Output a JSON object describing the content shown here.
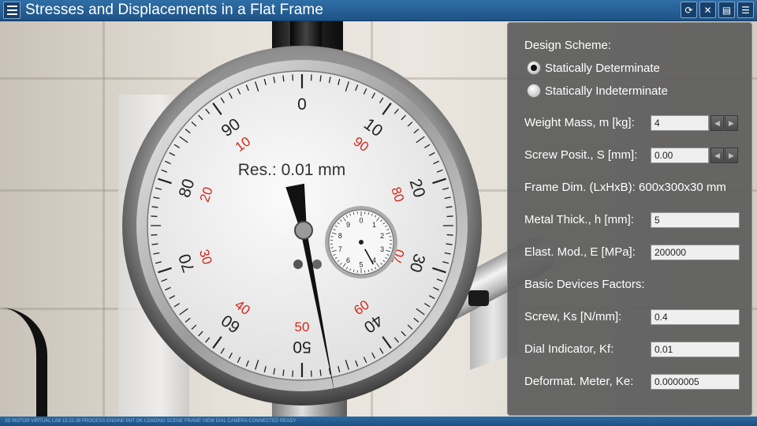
{
  "app": {
    "title": "Stresses and Displacements in a Flat Frame",
    "status_text": "3D MOTOR VIRTUAL LAB 15.22.38 PROCESS ENGINE INIT OK  LOADING SCENE  FRAME VIEW  DIAL CAMERA  CONNECTED  READY"
  },
  "toolbar": {
    "menu_icon": "hamburger-menu-icon",
    "buttons": [
      {
        "name": "reset-view-button",
        "icon": "refresh-icon",
        "glyph": "⟳"
      },
      {
        "name": "mute-sound-button",
        "icon": "speaker-mute-icon",
        "glyph": "✕"
      },
      {
        "name": "theory-book-button",
        "icon": "book-icon",
        "glyph": "▤"
      },
      {
        "name": "settings-list-button",
        "icon": "list-icon",
        "glyph": "☰"
      }
    ]
  },
  "panel": {
    "design_scheme_label": "Design Scheme:",
    "scheme_options": [
      {
        "label": "Statically Determinate",
        "selected": true
      },
      {
        "label": "Statically Indeterminate",
        "selected": false
      }
    ],
    "weight_mass_label": "Weight Mass, m [kg]:",
    "weight_mass_value": "4",
    "screw_position_label": "Screw Posit., S [mm]:",
    "screw_position_value": "0.00",
    "frame_dims_label": "Frame Dim. (LxHxB): 600x300x30 mm",
    "metal_thickness_label": "Metal Thick., h [mm]:",
    "metal_thickness_value": "5",
    "elastic_modulus_label": "Elast. Mod., E [MPa]:",
    "elastic_modulus_value": "200000",
    "basic_factors_label": "Basic Devices Factors:",
    "screw_factor_label": "Screw, Ks [N/mm]:",
    "screw_factor_value": "0.4",
    "dial_factor_label": "Dial Indicator, Kf:",
    "dial_factor_value": "0.01",
    "deform_factor_label": "Deformat. Meter, Ke:",
    "deform_factor_value": "0.0000005",
    "stepper_left_icon": "arrow-left-icon",
    "stepper_right_icon": "arrow-right-icon"
  },
  "gauge": {
    "resolution_label": "Res.: 0.01 mm",
    "outer_scale_labels": [
      "0",
      "10",
      "20",
      "30",
      "40",
      "50",
      "60",
      "70",
      "80",
      "90"
    ],
    "inner_red_labels": [
      "10",
      "20",
      "30",
      "40",
      "50",
      "60",
      "70",
      "80",
      "90"
    ],
    "sub_dial_labels": [
      "0",
      "1",
      "2",
      "3",
      "4",
      "5",
      "6",
      "7",
      "8",
      "9"
    ],
    "needle_reading": 47,
    "sub_dial_reading": 0.3,
    "colors": {
      "red_scale": "#d3271c",
      "face": "#f1f1f1",
      "bezel": "#9a9a9a"
    }
  }
}
